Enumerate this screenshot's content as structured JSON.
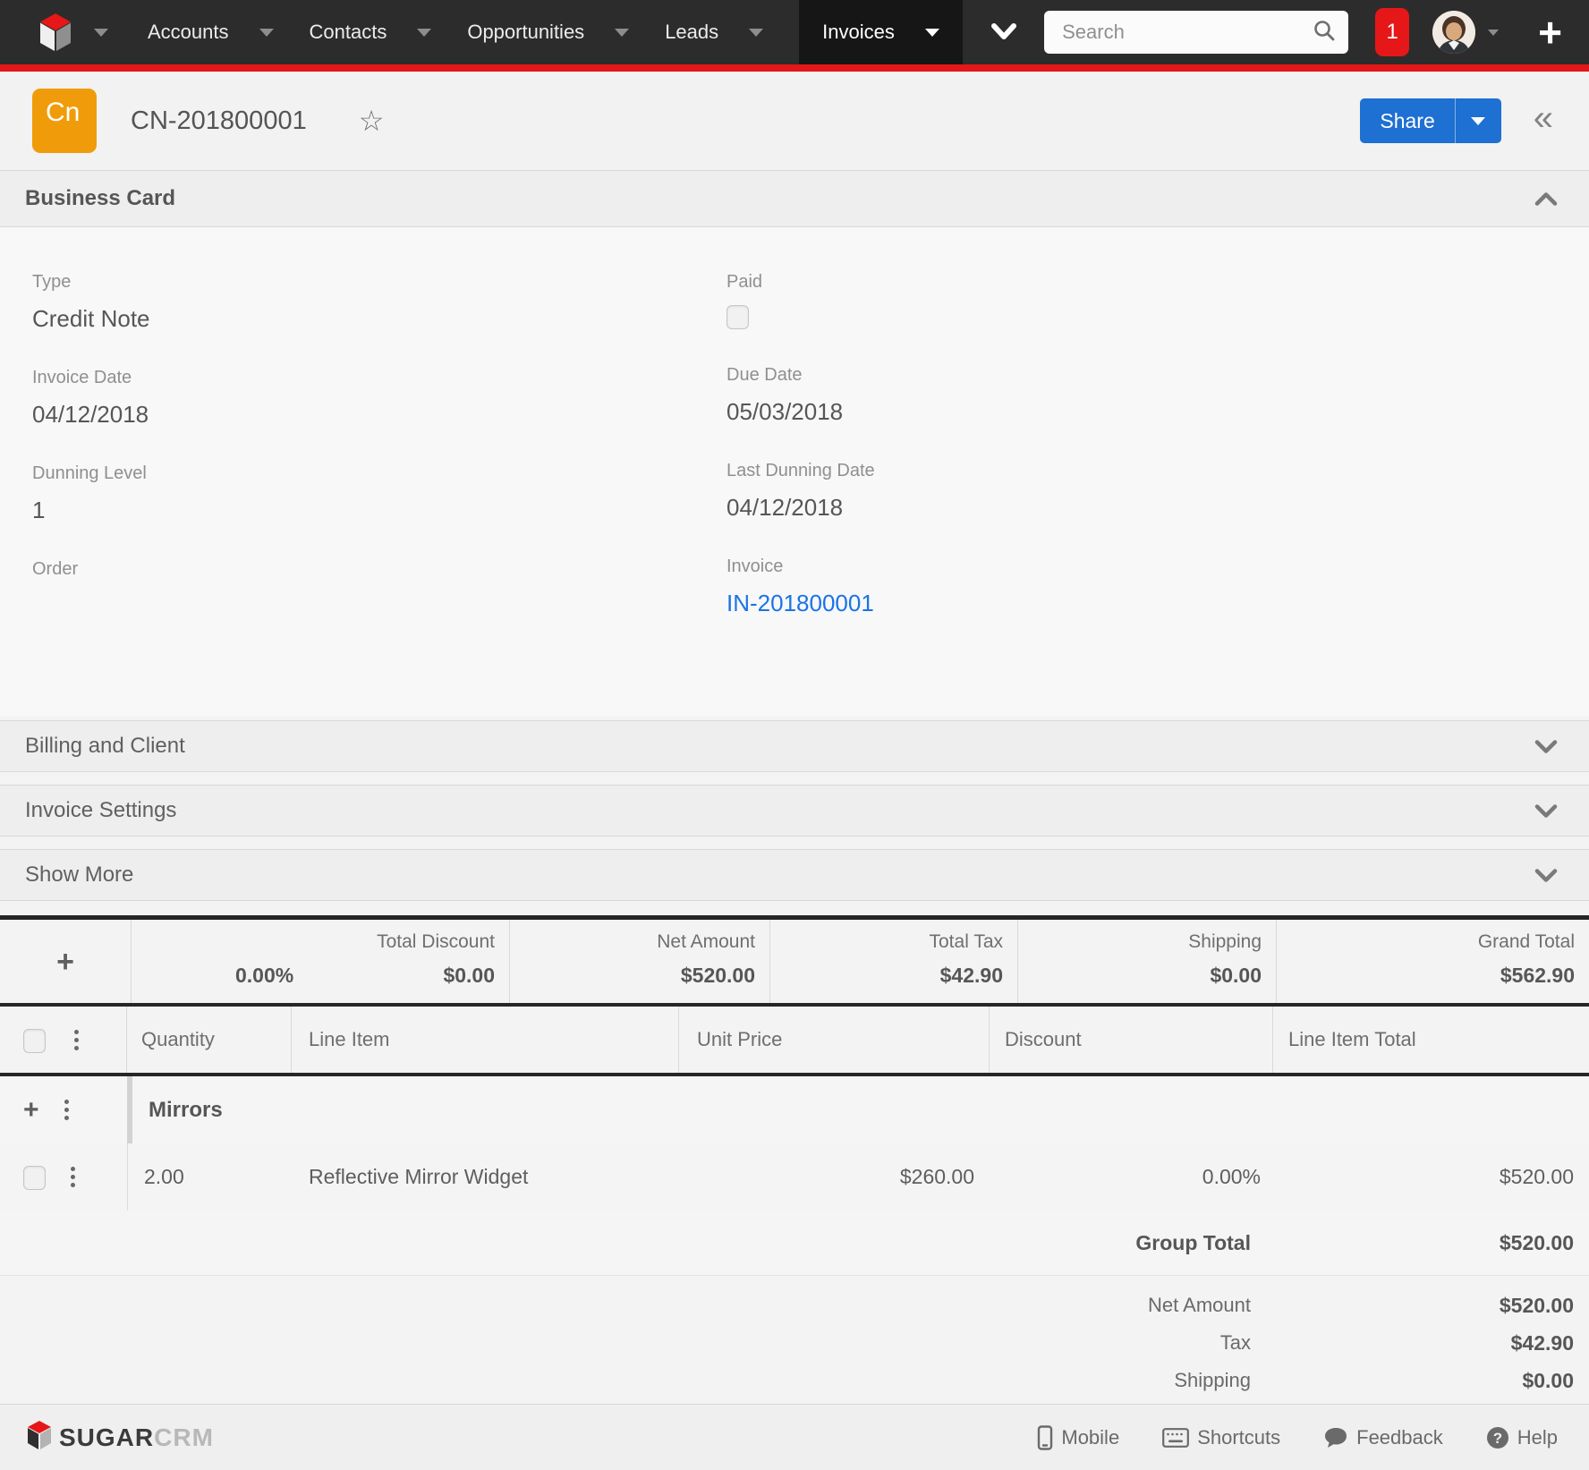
{
  "nav": {
    "modules": [
      {
        "label": "Accounts"
      },
      {
        "label": "Contacts"
      },
      {
        "label": "Opportunities"
      },
      {
        "label": "Leads"
      }
    ],
    "active_module": {
      "label": "Invoices"
    },
    "search": {
      "placeholder": "Search"
    },
    "notifications": {
      "count": "1"
    }
  },
  "header": {
    "icon_text": "Cn",
    "title": "CN-201800001",
    "share_label": "Share",
    "collapse_glyph": "«",
    "star_glyph": "☆"
  },
  "business_card": {
    "title": "Business Card",
    "left_fields": [
      {
        "label": "Type",
        "value": "Credit Note"
      },
      {
        "label": "Invoice Date",
        "value": "04/12/2018"
      },
      {
        "label": "Dunning Level",
        "value": "1"
      },
      {
        "label": "Order",
        "value": ""
      }
    ],
    "right_fields": [
      {
        "label": "Paid",
        "checked": false
      },
      {
        "label": "Due Date",
        "value": "05/03/2018"
      },
      {
        "label": "Last Dunning Date",
        "value": "04/12/2018"
      },
      {
        "label": "Invoice",
        "value": "IN-201800001"
      }
    ]
  },
  "collapsed_panels": [
    {
      "title": "Billing and Client"
    },
    {
      "title": "Invoice Settings"
    },
    {
      "title": "Show More"
    }
  ],
  "totals": {
    "discount": {
      "label": "Total Discount",
      "percent": "0.00%",
      "amount": "$0.00"
    },
    "net": {
      "label": "Net Amount",
      "amount": "$520.00"
    },
    "tax": {
      "label": "Total Tax",
      "amount": "$42.90"
    },
    "shipping": {
      "label": "Shipping",
      "amount": "$0.00"
    },
    "grand": {
      "label": "Grand Total",
      "amount": "$562.90"
    }
  },
  "items_table": {
    "columns": {
      "quantity": "Quantity",
      "line_item": "Line Item",
      "unit_price": "Unit Price",
      "discount": "Discount",
      "total": "Line Item Total"
    },
    "group": {
      "name": "Mirrors",
      "total_label": "Group Total",
      "total": "$520.00"
    },
    "rows": [
      {
        "quantity": "2.00",
        "line_item": "Reflective Mirror Widget",
        "unit_price": "$260.00",
        "discount": "0.00%",
        "total": "$520.00"
      }
    ],
    "summary": [
      {
        "label": "Net Amount",
        "value": "$520.00"
      },
      {
        "label": "Tax",
        "value": "$42.90"
      },
      {
        "label": "Shipping",
        "value": "$0.00"
      }
    ]
  },
  "footer": {
    "brand": {
      "bold": "SUGAR",
      "light": "CRM"
    },
    "links": [
      {
        "label": "Mobile",
        "icon": "mobile-icon"
      },
      {
        "label": "Shortcuts",
        "icon": "keyboard-icon"
      },
      {
        "label": "Feedback",
        "icon": "feedback-icon"
      },
      {
        "label": "Help",
        "icon": "help-icon"
      }
    ]
  },
  "colors": {
    "accent_red": "#e61718",
    "navbar_bg": "#2c2c2c",
    "link_blue": "#1a73e8",
    "share_blue": "#1e70d2",
    "module_icon_orange": "#f09c0a"
  }
}
